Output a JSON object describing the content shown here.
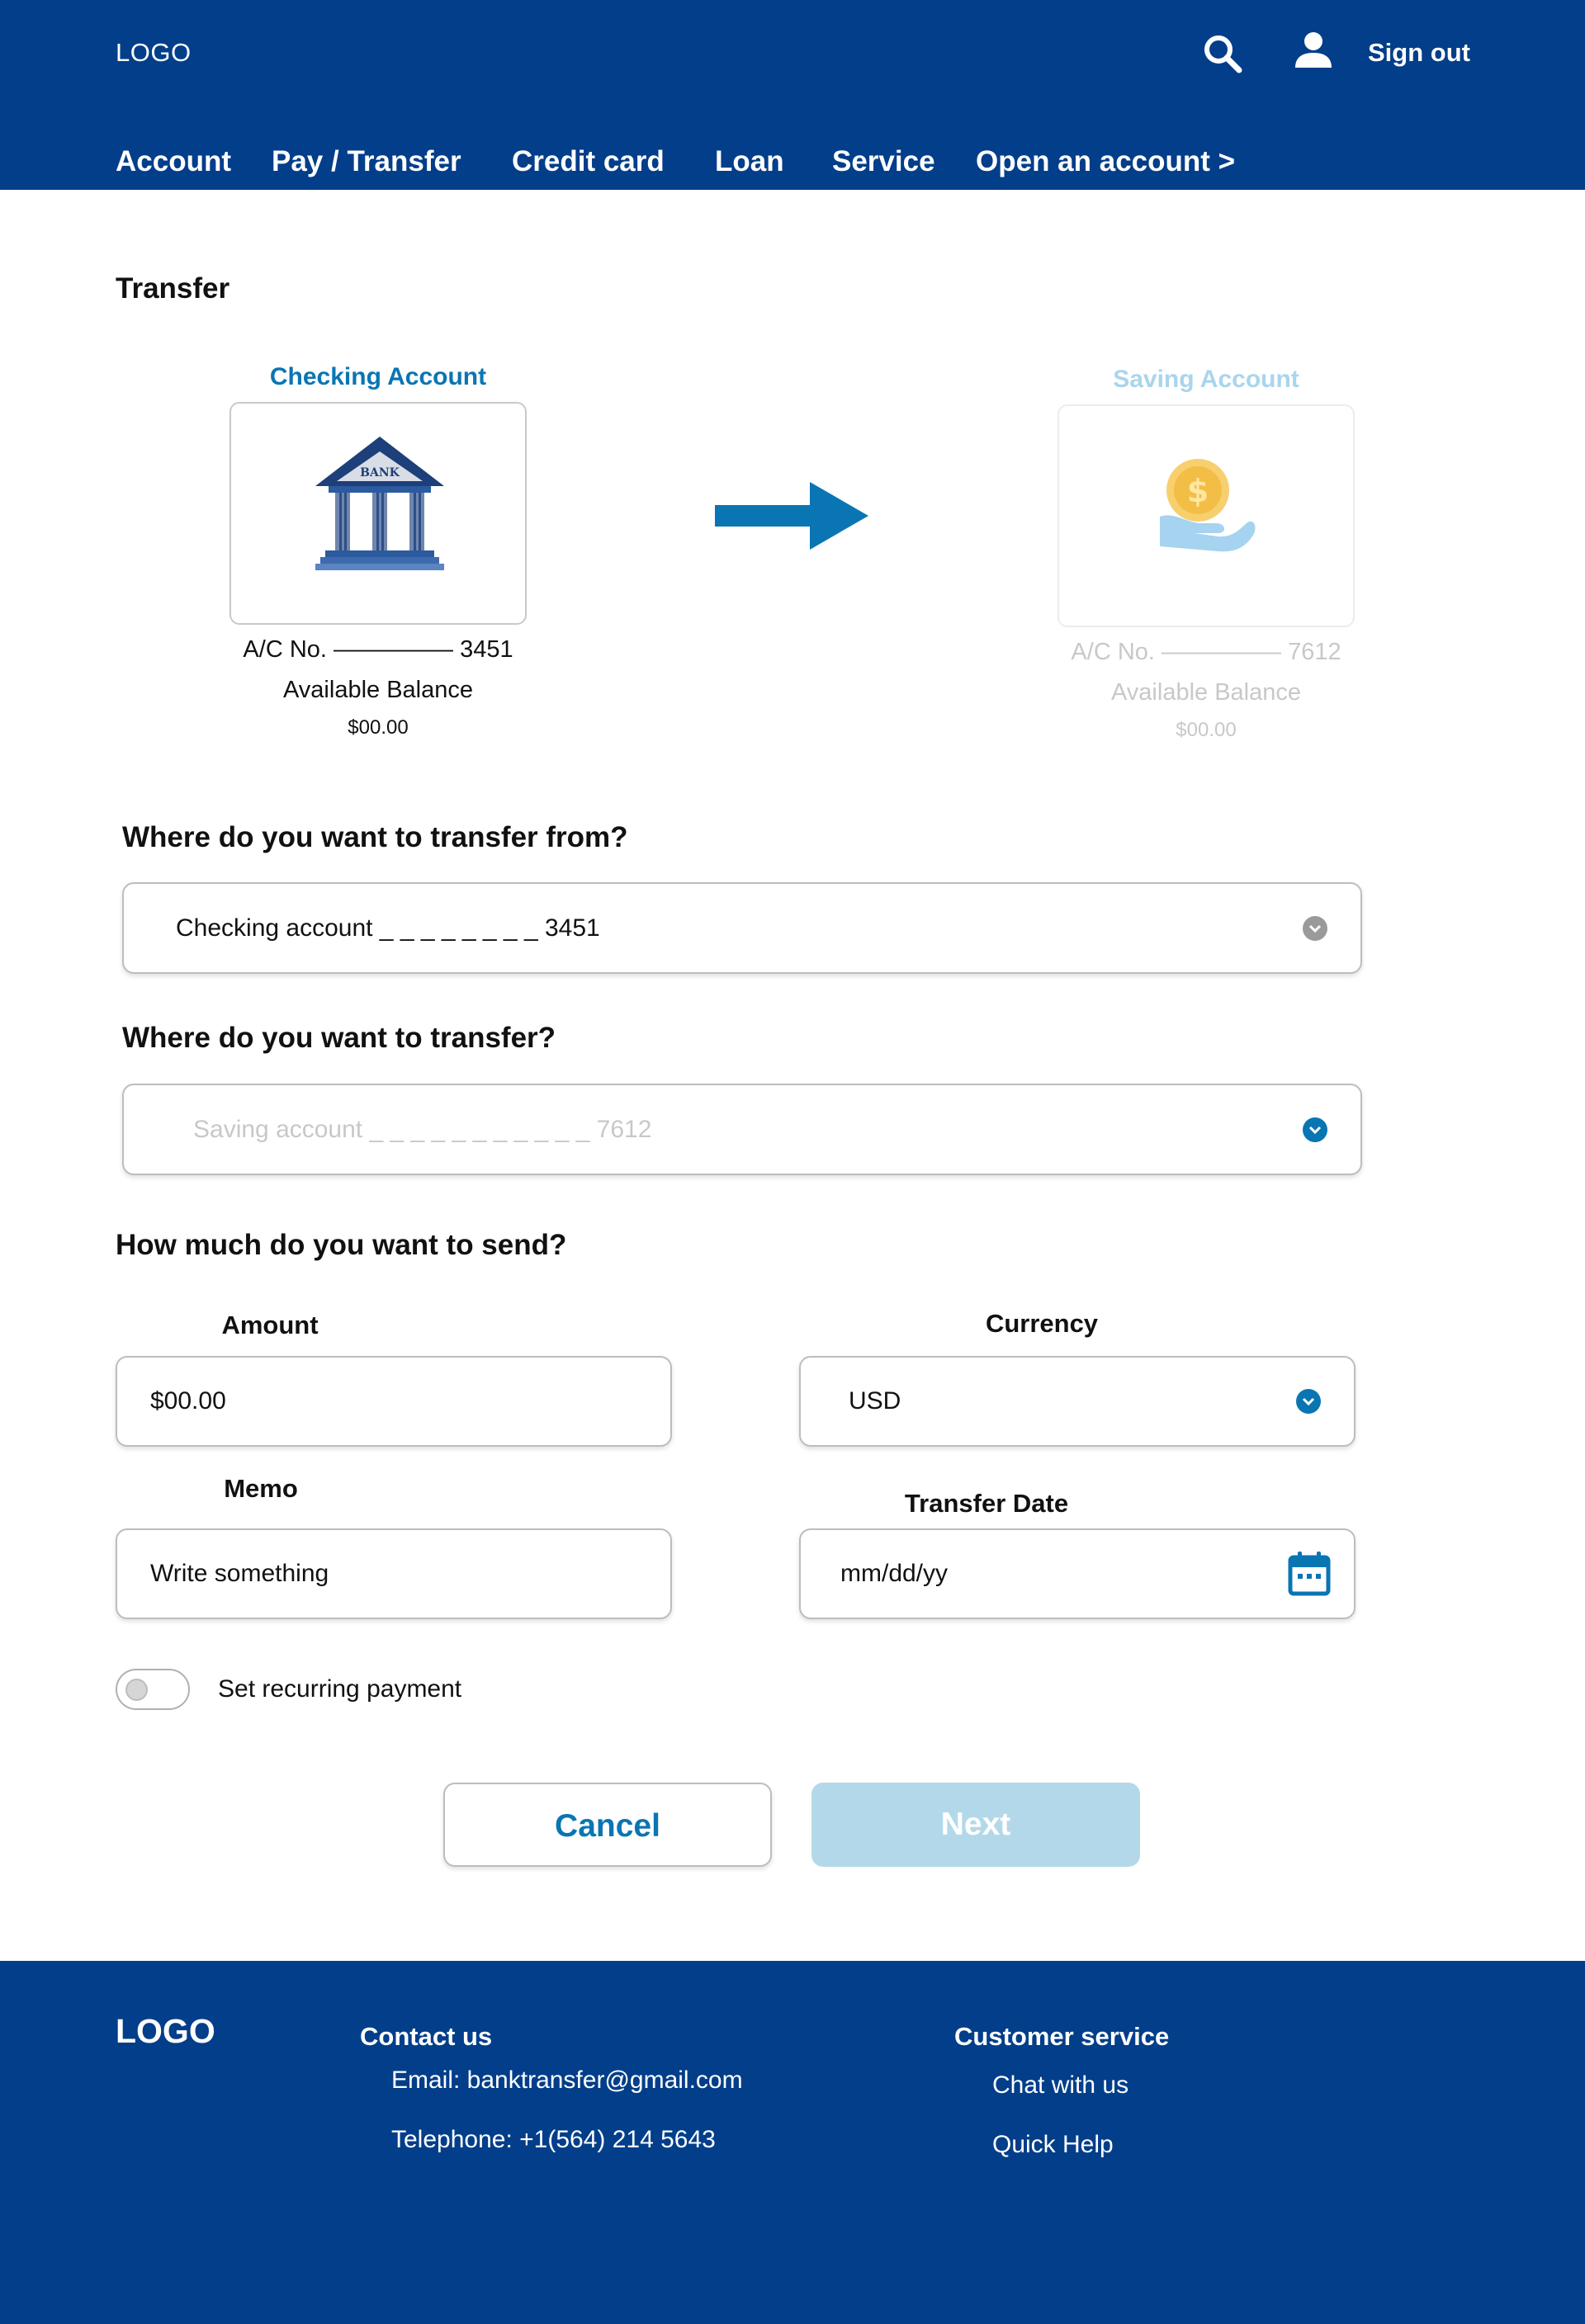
{
  "header": {
    "logo": "LOGO",
    "search_icon": "search-icon",
    "user_icon": "user-icon",
    "sign_out": "Sign out",
    "nav": [
      "Account",
      "Pay / Transfer",
      "Credit card",
      "Loan",
      "Service",
      "Open an account >"
    ]
  },
  "main": {
    "title": "Transfer",
    "from_account": {
      "title": "Checking Account",
      "image_icon": "bank-building-icon",
      "bank_sign": "BANK",
      "ac_no": "A/C No. —————  3451",
      "balance_label": "Available Balance",
      "balance": "$00.00"
    },
    "to_account": {
      "title": "Saving Account",
      "image_icon": "coin-hand-icon",
      "ac_no": "A/C No. —————  7612",
      "balance_label": "Available Balance",
      "balance": "$00.00"
    },
    "q_from": "Where do you want to transfer from?",
    "from_select": "Checking account _ _ _ _ _ _ _ _ 3451",
    "q_to": "Where do you want to transfer?",
    "to_select": "Saving account _ _ _ _ _ _ _ _ _ _ _ 7612",
    "q_amount": "How much do you want to send?",
    "amount_label": "Amount",
    "amount_value": "$00.00",
    "currency_label": "Currency",
    "currency_value": "USD",
    "memo_label": "Memo",
    "memo_value": "Write something",
    "date_label": "Transfer Date",
    "date_value": "mm/dd/yy",
    "recurring_label": "Set recurring payment",
    "recurring_on": false,
    "cancel": "Cancel",
    "next": "Next"
  },
  "footer": {
    "logo": "LOGO",
    "contact_heading": "Contact us",
    "email": "Email: banktransfer@gmail.com",
    "telephone": "Telephone: +1(564) 214 5643",
    "service_heading": "Customer service",
    "chat": "Chat with us",
    "help": "Quick Help"
  },
  "colors": {
    "brand_blue": "#023E8A",
    "accent_blue": "#0A75B3",
    "disabled_blue": "#B3D8EA",
    "faded_text": "#C8C8C8"
  }
}
